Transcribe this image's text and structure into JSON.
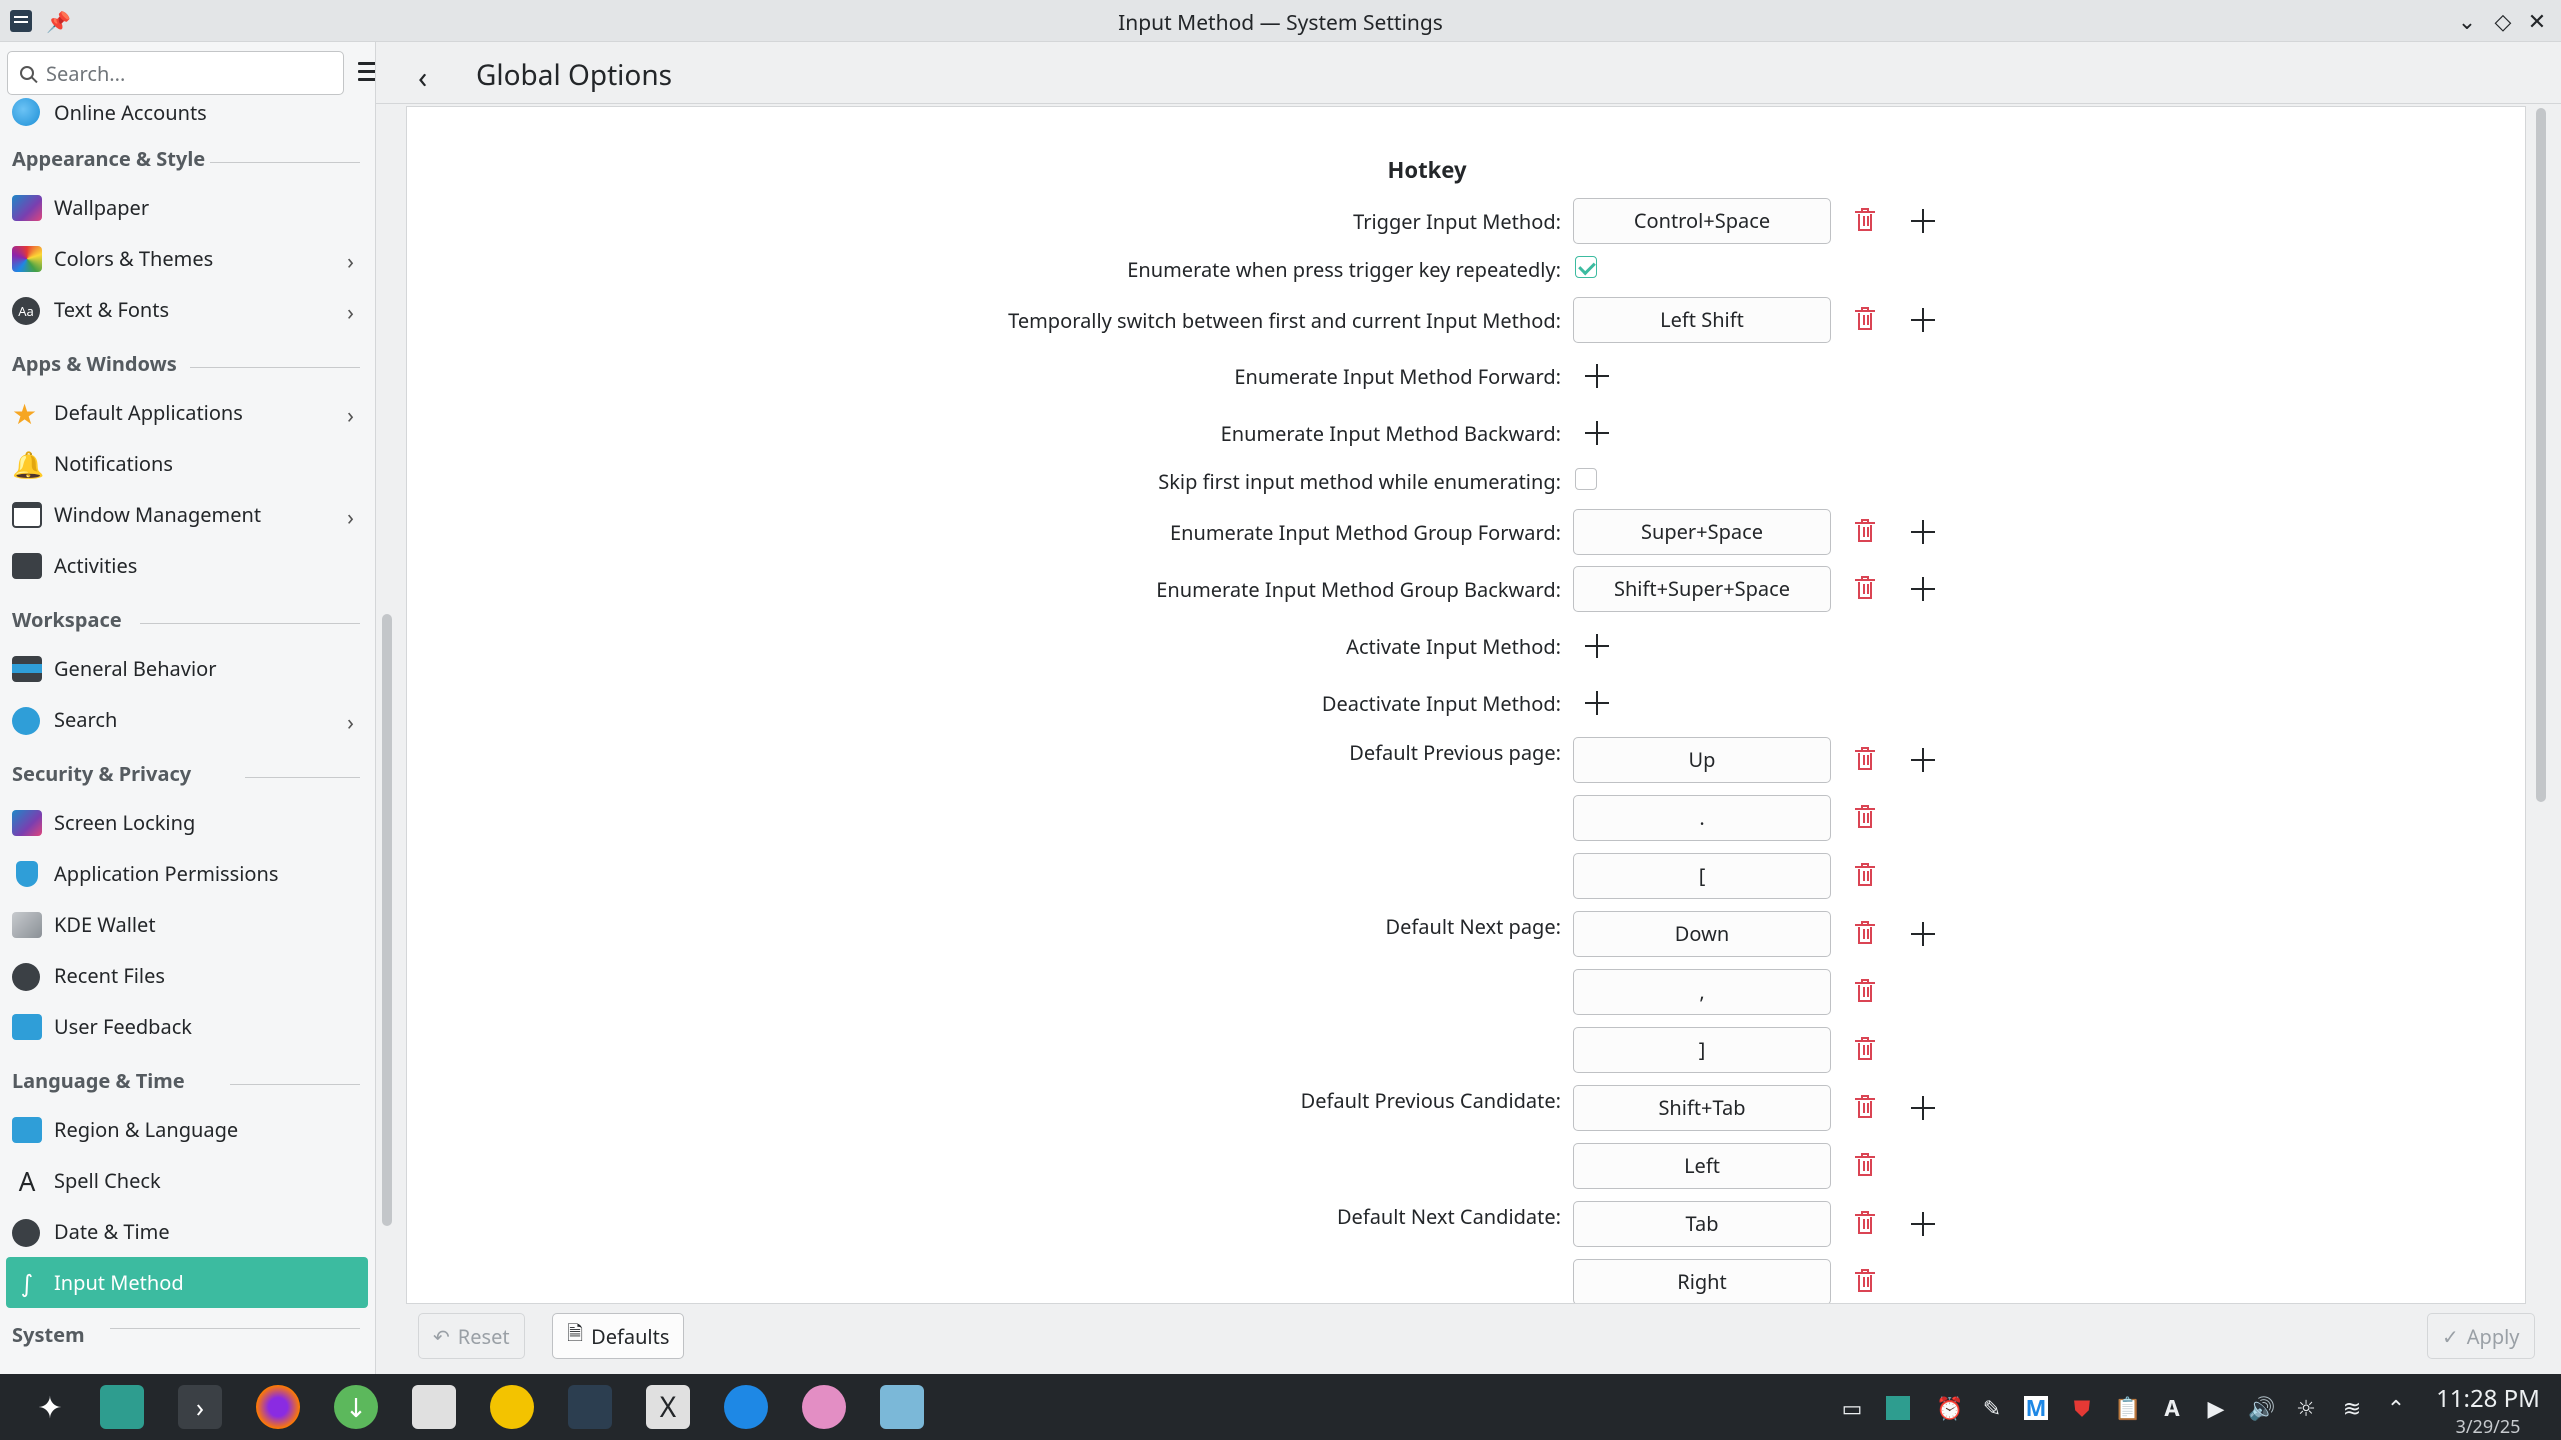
{
  "window": {
    "title": "Input Method — System Settings"
  },
  "sidebar": {
    "search_placeholder": "Search...",
    "top_item": "Online Accounts",
    "sections": {
      "appearance": "Appearance & Style",
      "apps": "Apps & Windows",
      "workspace": "Workspace",
      "security": "Security & Privacy",
      "language": "Language & Time",
      "system": "System"
    },
    "items": {
      "wallpaper": "Wallpaper",
      "colors": "Colors & Themes",
      "text_fonts": "Text & Fonts",
      "default_apps": "Default Applications",
      "notifications": "Notifications",
      "window_mgmt": "Window Management",
      "activities": "Activities",
      "general_behavior": "General Behavior",
      "search": "Search",
      "screen_locking": "Screen Locking",
      "app_permissions": "Application Permissions",
      "kde_wallet": "KDE Wallet",
      "recent_files": "Recent Files",
      "user_feedback": "User Feedback",
      "region_language": "Region & Language",
      "spell_check": "Spell Check",
      "date_time": "Date & Time",
      "input_method": "Input Method"
    }
  },
  "header": {
    "title": "Global Options"
  },
  "hotkey": {
    "title": "Hotkey",
    "trigger_label": "Trigger Input Method:",
    "trigger_key": "Control+Space",
    "enumerate_repeat_label": "Enumerate when press trigger key repeatedly:",
    "temp_switch_label": "Temporally switch between first and current Input Method:",
    "temp_switch_key": "Left Shift",
    "enum_forward_label": "Enumerate Input Method Forward:",
    "enum_backward_label": "Enumerate Input Method Backward:",
    "skip_first_label": "Skip first input method while enumerating:",
    "group_forward_label": "Enumerate Input Method Group Forward:",
    "group_forward_key": "Super+Space",
    "group_backward_label": "Enumerate Input Method Group Backward:",
    "group_backward_key": "Shift+Super+Space",
    "activate_label": "Activate Input Method:",
    "deactivate_label": "Deactivate Input Method:",
    "prev_page_label": "Default Previous page:",
    "prev_page_keys": [
      "Up",
      ".",
      "["
    ],
    "next_page_label": "Default Next page:",
    "next_page_keys": [
      "Down",
      ",",
      "]"
    ],
    "prev_cand_label": "Default Previous Candidate:",
    "prev_cand_keys": [
      "Shift+Tab",
      "Left"
    ],
    "next_cand_label": "Default Next Candidate:",
    "next_cand_keys": [
      "Tab",
      "Right"
    ]
  },
  "footer": {
    "reset": "Reset",
    "defaults": "Defaults",
    "apply": "Apply"
  },
  "taskbar": {
    "time": "11:28 PM",
    "date": "3/29/25"
  },
  "colors": {
    "accent": "#3cbba0",
    "danger": "#da4453"
  }
}
